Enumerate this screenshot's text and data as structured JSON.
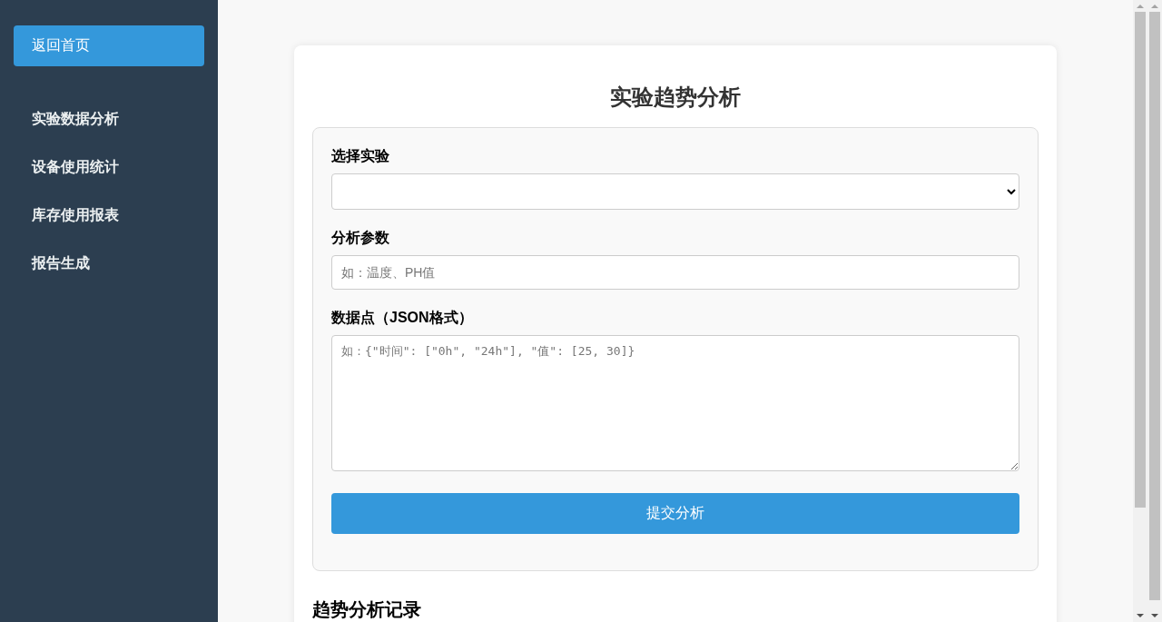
{
  "sidebar": {
    "home_button": "返回首页",
    "items": [
      {
        "label": "实验数据分析"
      },
      {
        "label": "设备使用统计"
      },
      {
        "label": "库存使用报表"
      },
      {
        "label": "报告生成"
      }
    ]
  },
  "card": {
    "title": "实验趋势分析",
    "form": {
      "experiment_label": "选择实验",
      "parameter_label": "分析参数",
      "parameter_placeholder": "如：温度、PH值",
      "datapoints_label": "数据点（JSON格式）",
      "datapoints_placeholder": "如：{\"时间\": [\"0h\", \"24h\"], \"值\": [25, 30]}",
      "submit_button": "提交分析"
    },
    "records_title": "趋势分析记录"
  }
}
